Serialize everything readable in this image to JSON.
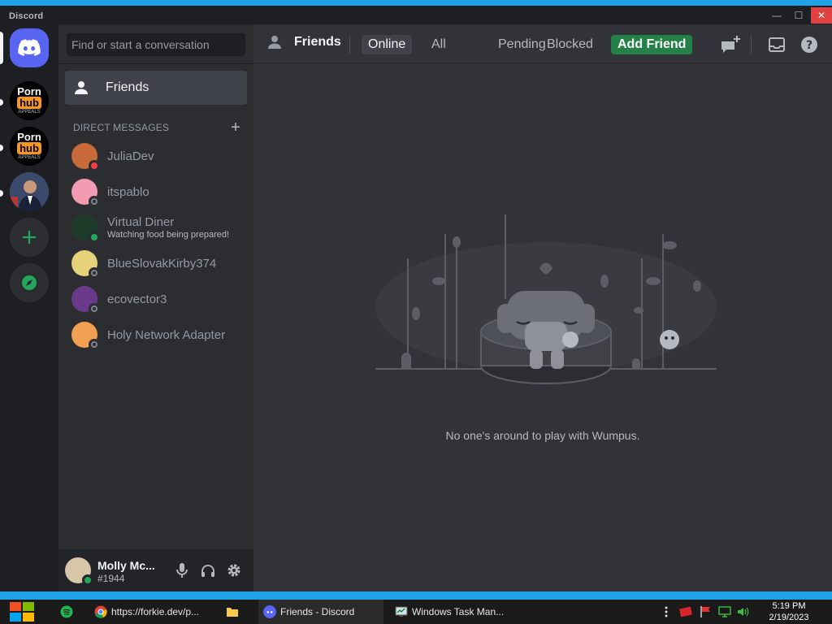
{
  "window": {
    "app_title": "Discord",
    "min_glyph": "—",
    "max_glyph": "☐",
    "close_glyph": "✕"
  },
  "servers": [
    {
      "name": "home",
      "icon": "discord-logo-icon"
    },
    {
      "label_top": "Porn",
      "label_box": "hub",
      "label_small": "APPEALS"
    },
    {
      "label_top": "Porn",
      "label_box": "hub",
      "label_small": "APPEALS"
    },
    {
      "icon": "portrait-avatar"
    },
    {
      "icon": "plus-icon"
    },
    {
      "icon": "compass-icon"
    }
  ],
  "sidebar": {
    "search_placeholder": "Find or start a conversation",
    "friends_label": "Friends",
    "dm_header": "DIRECT MESSAGES",
    "dm_add": "+",
    "dms": [
      {
        "name": "JuliaDev",
        "status": "dnd",
        "sub": ""
      },
      {
        "name": "itspablo",
        "status": "offline",
        "sub": ""
      },
      {
        "name": "Virtual Diner",
        "status": "online",
        "sub": "Watching food being prepared!"
      },
      {
        "name": "BlueSlovakKirby374",
        "status": "offline",
        "sub": ""
      },
      {
        "name": "ecovector3",
        "status": "offline",
        "sub": ""
      },
      {
        "name": "Holy Network Adapter",
        "status": "offline",
        "sub": ""
      }
    ]
  },
  "user": {
    "name": "Molly Mc...",
    "tag": "#1944"
  },
  "topbar": {
    "title": "Friends",
    "tabs": [
      "Online",
      "All",
      "Pending",
      "Blocked"
    ],
    "add_friend": "Add Friend"
  },
  "main": {
    "empty_text": "No one's around to play with Wumpus."
  },
  "taskbar": {
    "items": [
      {
        "label": "https://forkie.dev/p..."
      },
      {
        "label": "Friends - Discord"
      },
      {
        "label": "Windows Task Man..."
      }
    ],
    "time": "5:19 PM",
    "date": "2/19/2023"
  },
  "colors": {
    "blurple": "#5865f2",
    "online_green": "#23a55a",
    "dnd_red": "#f23f43",
    "add_friend_green": "#248046"
  }
}
